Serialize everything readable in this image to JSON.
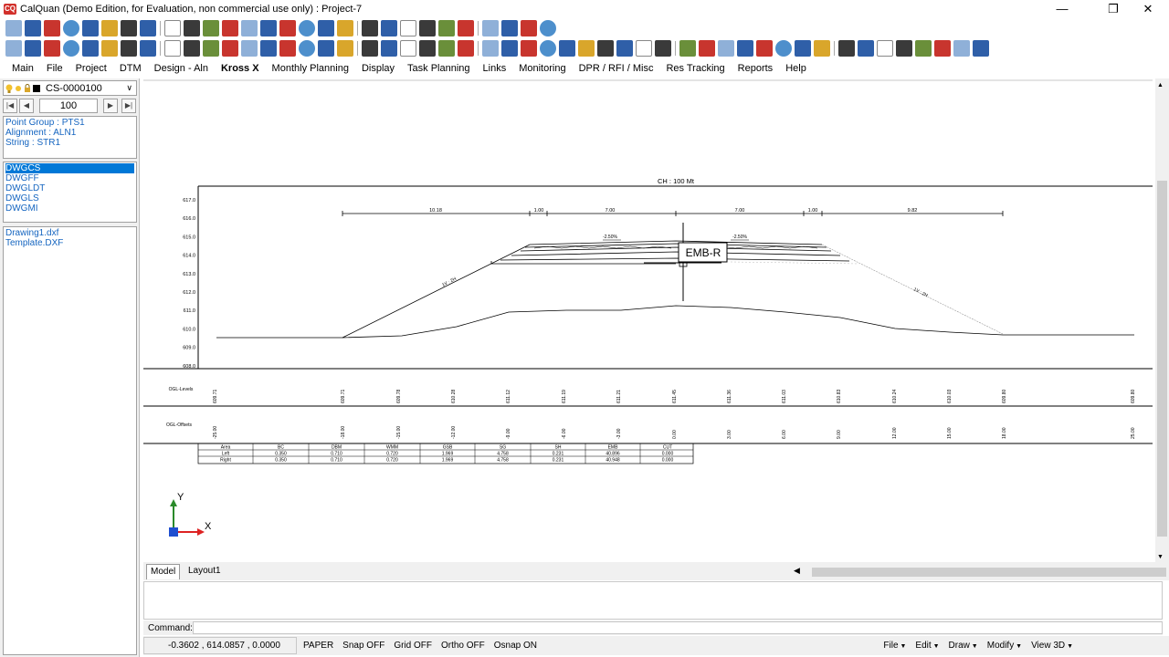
{
  "window": {
    "app_logo": "CQ",
    "title": "CalQuan (Demo Edition, for Evaluation, non commercial use only) :  Project-7",
    "controls": {
      "minimize": "—",
      "restore": "❐",
      "close": "✕"
    }
  },
  "menubar": {
    "items": [
      "Main",
      "File",
      "Project",
      "DTM",
      "Design - Aln",
      "Kross X",
      "Monthly Planning",
      "Display",
      "Task Planning",
      "Links",
      "Monitoring",
      "DPR / RFI / Misc",
      "Res Tracking",
      "Reports",
      "Help"
    ],
    "active_index": 5
  },
  "left_panel": {
    "cross_section": {
      "value": "CS-0000100",
      "arrow": "∨"
    },
    "nav": {
      "first": "|◀",
      "prev": "◀",
      "chainage": "100",
      "next": "▶",
      "last": "▶|"
    },
    "info": [
      "Point Group : PTS1",
      "Alignment : ALN1",
      "String : STR1"
    ],
    "layers": [
      "DWGCS",
      "DWGFF",
      "DWGLDT",
      "DWGLS",
      "DWGMI"
    ],
    "selected_layer": 0,
    "files": [
      "Drawing1.dxf",
      "Template.DXF"
    ]
  },
  "drawing": {
    "chainage_title": "CH : 100 Mt",
    "y_axis": [
      "617.0",
      "616.0",
      "615.0",
      "614.0",
      "613.0",
      "612.0",
      "611.0",
      "610.0",
      "609.0",
      "608.0"
    ],
    "dimensions": [
      "10.18",
      "1.00",
      "7.00",
      "7.00",
      "1.00",
      "9.82"
    ],
    "camber_left": "-2.50%",
    "camber_right": "-2.50%",
    "slope_left": "1V : 2H",
    "slope_right": "1V : 2H",
    "label_box": "EMB-R",
    "ogl_levels_label": "OGL-Levels",
    "ogl_levels": [
      "609.71",
      "609.71",
      "609.78",
      "610.28",
      "611.12",
      "611.19",
      "611.21",
      "611.45",
      "611.36",
      "611.03",
      "610.83",
      "610.24",
      "610.03",
      "609.80",
      "609.80"
    ],
    "ogl_offsets_label": "OGL-Offsets",
    "ogl_offsets": [
      "-25.00",
      "-18.00",
      "-15.00",
      "-12.00",
      "-9.00",
      "-6.00",
      "-3.00",
      "0.00",
      "3.00",
      "6.00",
      "9.00",
      "12.00",
      "15.00",
      "18.00",
      "25.00"
    ],
    "area_table": {
      "headers": [
        "Area",
        "BC",
        "DBM",
        "WMM",
        "GSB",
        "SG",
        "SH",
        "EMB",
        "CUT"
      ],
      "rows": [
        [
          "Left",
          "0.350",
          "0.710",
          "0.720",
          "1.969",
          "4.758",
          "0.231",
          "40.896",
          "0.000"
        ],
        [
          "Right",
          "0.350",
          "0.710",
          "0.720",
          "1.969",
          "4.758",
          "0.231",
          "40.948",
          "0.000"
        ]
      ]
    },
    "ucs": {
      "x": "X",
      "y": "Y"
    }
  },
  "tabs": [
    "Model",
    "Layout1"
  ],
  "active_tab": 0,
  "command": {
    "label": "Command:",
    "value": ""
  },
  "status": {
    "coords": "-0.3602 , 614.0857 , 0.0000",
    "modes": [
      "PAPER",
      "Snap OFF",
      "Grid OFF",
      "Ortho OFF",
      "Osnap ON"
    ],
    "menus": [
      "File",
      "Edit",
      "Draw",
      "Modify",
      "View 3D"
    ]
  },
  "colors": {
    "accent": "#0078d7",
    "text_blue": "#1565c0",
    "panel_bg": "#f0f0f0"
  },
  "toolbar_icons": {
    "row1": [
      "new-icon",
      "open-icon",
      "save-icon",
      "layer-icon",
      "point-icon",
      "grid-icon",
      "pan-icon",
      "zoom-window-icon",
      "zoom-extents-icon",
      "text-icon",
      "polyline-icon",
      "circle-icon",
      "arc-icon",
      "rectangle-icon",
      "dimension-icon",
      "copy-icon",
      "cut-icon",
      "paste-icon"
    ],
    "row2": [
      "print-icon",
      "snap-icon",
      "bulb-icon",
      "magnet-icon",
      "undo-icon",
      "redo-icon",
      "zoom-in-icon",
      "zoom-out-icon",
      "table-icon",
      "settings-icon",
      "move-icon",
      "rotate-icon",
      "mirror-icon",
      "trim-icon",
      "extend-icon",
      "text-style-icon"
    ]
  }
}
